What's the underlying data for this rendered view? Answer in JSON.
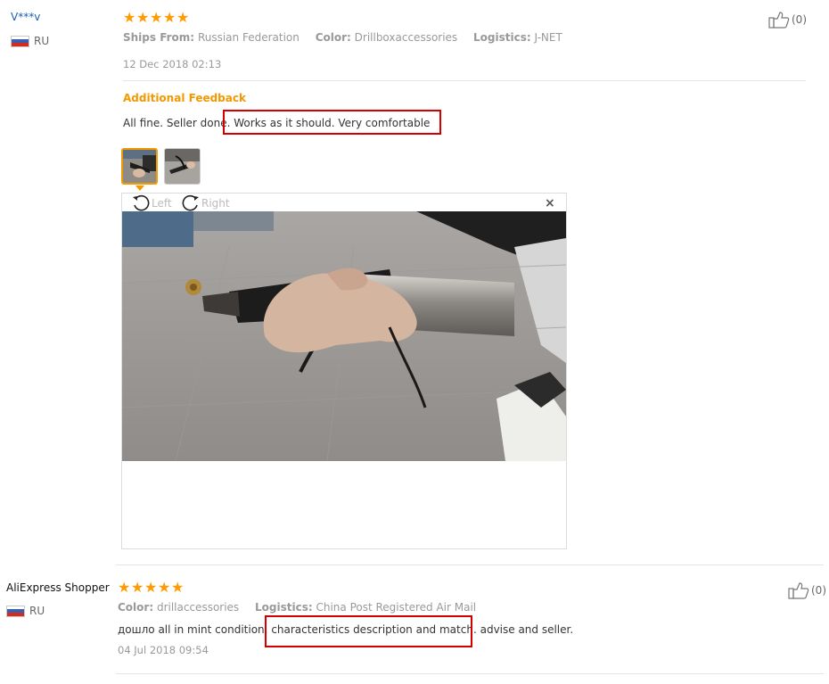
{
  "reviews": [
    {
      "user": "V***v",
      "country": "RU",
      "rating": 5,
      "ships_from_label": "Ships From:",
      "ships_from": "Russian Federation",
      "color_label": "Color:",
      "color": "Drillboxaccessories",
      "logistics_label": "Logistics:",
      "logistics": "J-NET",
      "date": "12 Dec 2018 02:13",
      "additional_feedback_label": "Additional Feedback",
      "text_before": "All fine. Seller done.",
      "text_highlight": "Works as it should. Very comfortable",
      "likes": "(0)",
      "viewer": {
        "left_label": "Left",
        "right_label": "Right",
        "close_label": "×"
      }
    },
    {
      "user": "AliExpress Shopper",
      "country": "RU",
      "rating": 5,
      "color_label": "Color:",
      "color": "drillaccessories",
      "logistics_label": "Logistics:",
      "logistics": "China Post Registered Air Mail",
      "text_before": "дошло all in mint condition.",
      "text_highlight": "characteristics description and match.",
      "text_after": "advise and seller.",
      "date": "04 Jul 2018 09:54",
      "likes": "(0)"
    }
  ],
  "colors": {
    "star": "#ff9a00",
    "feedback_heading": "#f39800",
    "highlight_box": "#d40000",
    "user_link": "#1a5fb4"
  }
}
